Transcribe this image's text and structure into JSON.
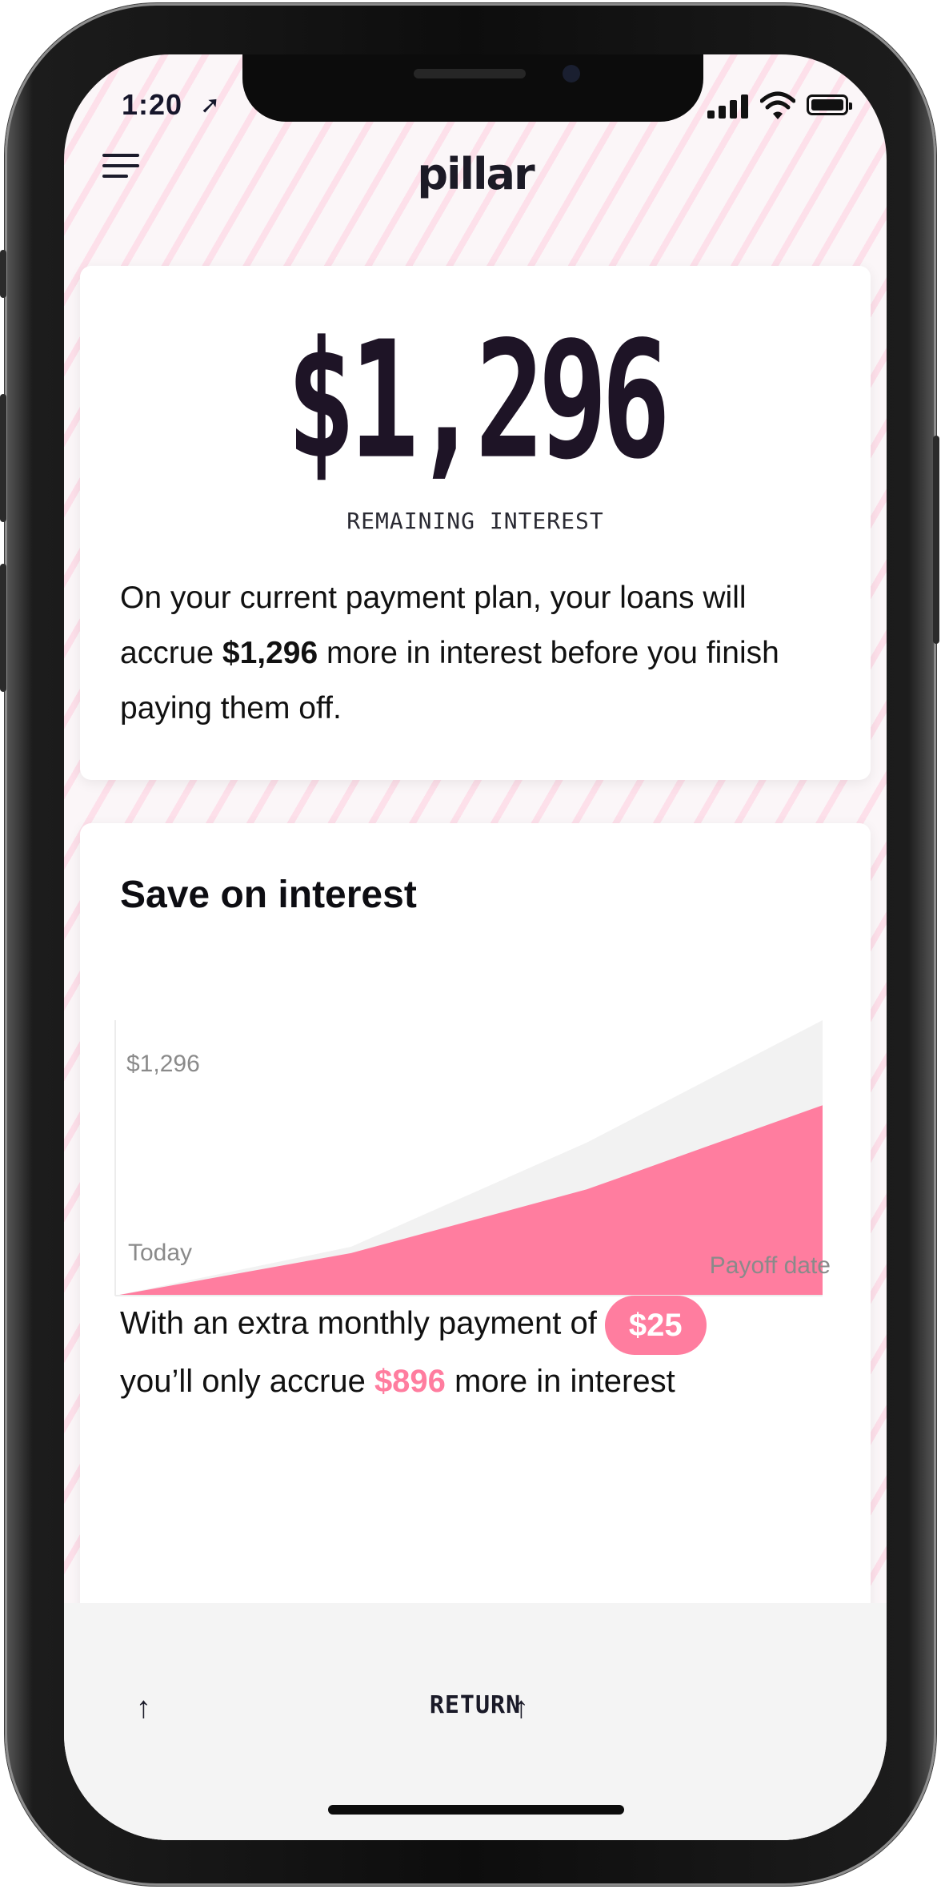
{
  "status_bar": {
    "time": "1:20",
    "location_icon": "location-arrow-icon",
    "signal_icon": "cellular-signal-icon",
    "wifi_icon": "wifi-icon",
    "battery_icon": "battery-icon"
  },
  "header": {
    "menu_icon": "hamburger-menu-icon",
    "logo_text": "pillar"
  },
  "interest_card": {
    "amount": "$1,296",
    "label": "REMAINING INTEREST",
    "desc_before": "On your current payment plan, your loans will accrue ",
    "desc_amount": "$1,296",
    "desc_after": " more in interest before you finish paying them off."
  },
  "save_card": {
    "title": "Save on interest",
    "start_label": "Today",
    "end_label": "Payoff date",
    "extra_before": "With an extra monthly payment of",
    "extra_amount": "$25",
    "result_before": "you’ll only accrue ",
    "result_amount": "$896",
    "result_after": " more in interest"
  },
  "chart_data": {
    "type": "area",
    "x": [
      "Today",
      "",
      "",
      "Payoff date"
    ],
    "series": [
      {
        "values": [
          0,
          200,
          500,
          896
        ]
      },
      {
        "values": [
          0,
          230,
          720,
          1296
        ]
      }
    ],
    "y_label_top": "$1,296",
    "ylim": [
      0,
      1296
    ],
    "colors": [
      "#ff7d9f",
      "#f2f2f2"
    ]
  },
  "bottom_bar": {
    "left_icon": "arrow-up-icon",
    "return_label": "RETURN",
    "right_icon": "arrow-up-icon"
  },
  "colors": {
    "accent": "#ff7d9f",
    "text_dark": "#1e1426"
  }
}
